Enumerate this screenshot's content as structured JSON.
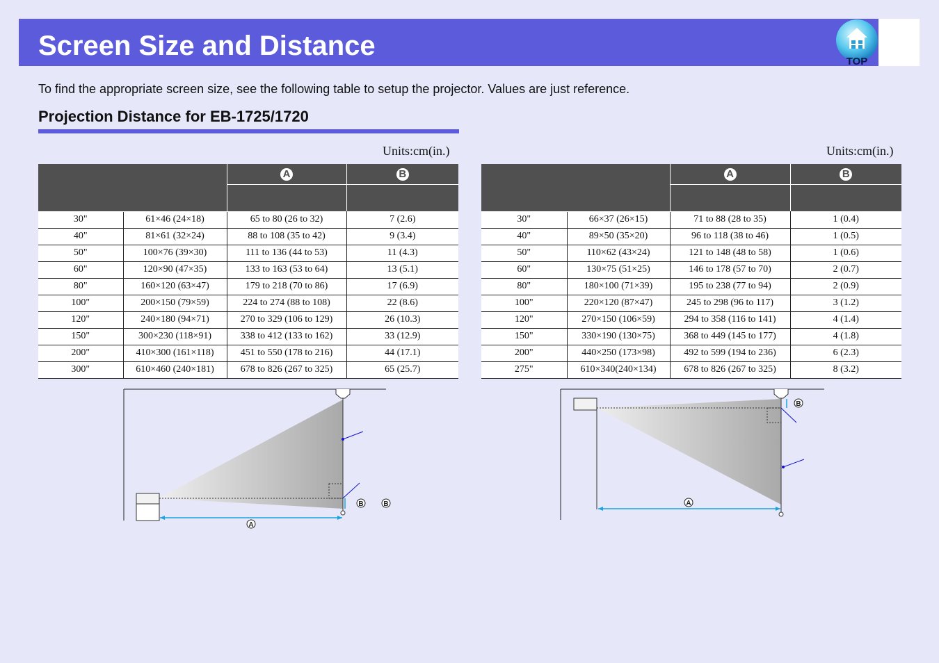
{
  "page": {
    "title": "Screen Size and Distance",
    "top_button_label": "TOP",
    "intro": "To find the appropriate screen size, see the following table to setup the projector. Values are just reference.",
    "section_heading": "Projection Distance for EB-1725/1720"
  },
  "colors": {
    "accent": "#5b5bdb",
    "background": "#e6e8fa",
    "table_header": "#505050",
    "dimension_line": "#1aa3e0",
    "callout_line": "#1111cc"
  },
  "markers": {
    "a": "A",
    "b": "B"
  },
  "tables": [
    {
      "units": "Units:cm(in.)",
      "rows": [
        [
          "30\"",
          "61×46 (24×18)",
          "65 to 80 (26 to 32)",
          "7 (2.6)"
        ],
        [
          "40\"",
          "81×61 (32×24)",
          "88 to 108 (35 to 42)",
          "9 (3.4)"
        ],
        [
          "50\"",
          "100×76 (39×30)",
          "111 to 136 (44 to 53)",
          "11 (4.3)"
        ],
        [
          "60\"",
          "120×90 (47×35)",
          "133 to 163 (53 to 64)",
          "13 (5.1)"
        ],
        [
          "80\"",
          "160×120 (63×47)",
          "179 to 218 (70 to 86)",
          "17 (6.9)"
        ],
        [
          "100\"",
          "200×150 (79×59)",
          "224 to 274 (88 to 108)",
          "22 (8.6)"
        ],
        [
          "120\"",
          "240×180 (94×71)",
          "270 to 329 (106 to 129)",
          "26 (10.3)"
        ],
        [
          "150\"",
          "300×230 (118×91)",
          "338 to 412 (133 to 162)",
          "33 (12.9)"
        ],
        [
          "200\"",
          "410×300 (161×118)",
          "451 to 550 (178 to 216)",
          "44 (17.1)"
        ],
        [
          "300\"",
          "610×460 (240×181)",
          "678 to 826 (267 to 325)",
          "65 (25.7)"
        ]
      ]
    },
    {
      "units": "Units:cm(in.)",
      "rows": [
        [
          "30\"",
          "66×37 (26×15)",
          "71 to 88 (28 to 35)",
          "1 (0.4)"
        ],
        [
          "40\"",
          "89×50 (35×20)",
          "96 to 118 (38 to 46)",
          "1 (0.5)"
        ],
        [
          "50\"",
          "110×62 (43×24)",
          "121 to 148 (48 to 58)",
          "1 (0.6)"
        ],
        [
          "60\"",
          "130×75 (51×25)",
          "146 to 178 (57 to 70)",
          "2 (0.7)"
        ],
        [
          "80\"",
          "180×100 (71×39)",
          "195 to 238 (77 to 94)",
          "2 (0.9)"
        ],
        [
          "100\"",
          "220×120 (87×47)",
          "245 to 298 (96 to 117)",
          "3 (1.2)"
        ],
        [
          "120\"",
          "270×150 (106×59)",
          "294 to 358 (116 to 141)",
          "4 (1.4)"
        ],
        [
          "150\"",
          "330×190 (130×75)",
          "368 to 449 (145 to 177)",
          "4 (1.8)"
        ],
        [
          "200\"",
          "440×250 (173×98)",
          "492 to 599 (194 to 236)",
          "6 (2.3)"
        ],
        [
          "275\"",
          "610×340(240×134)",
          "678 to 826 (267 to 325)",
          "8 (3.2)"
        ]
      ]
    }
  ]
}
